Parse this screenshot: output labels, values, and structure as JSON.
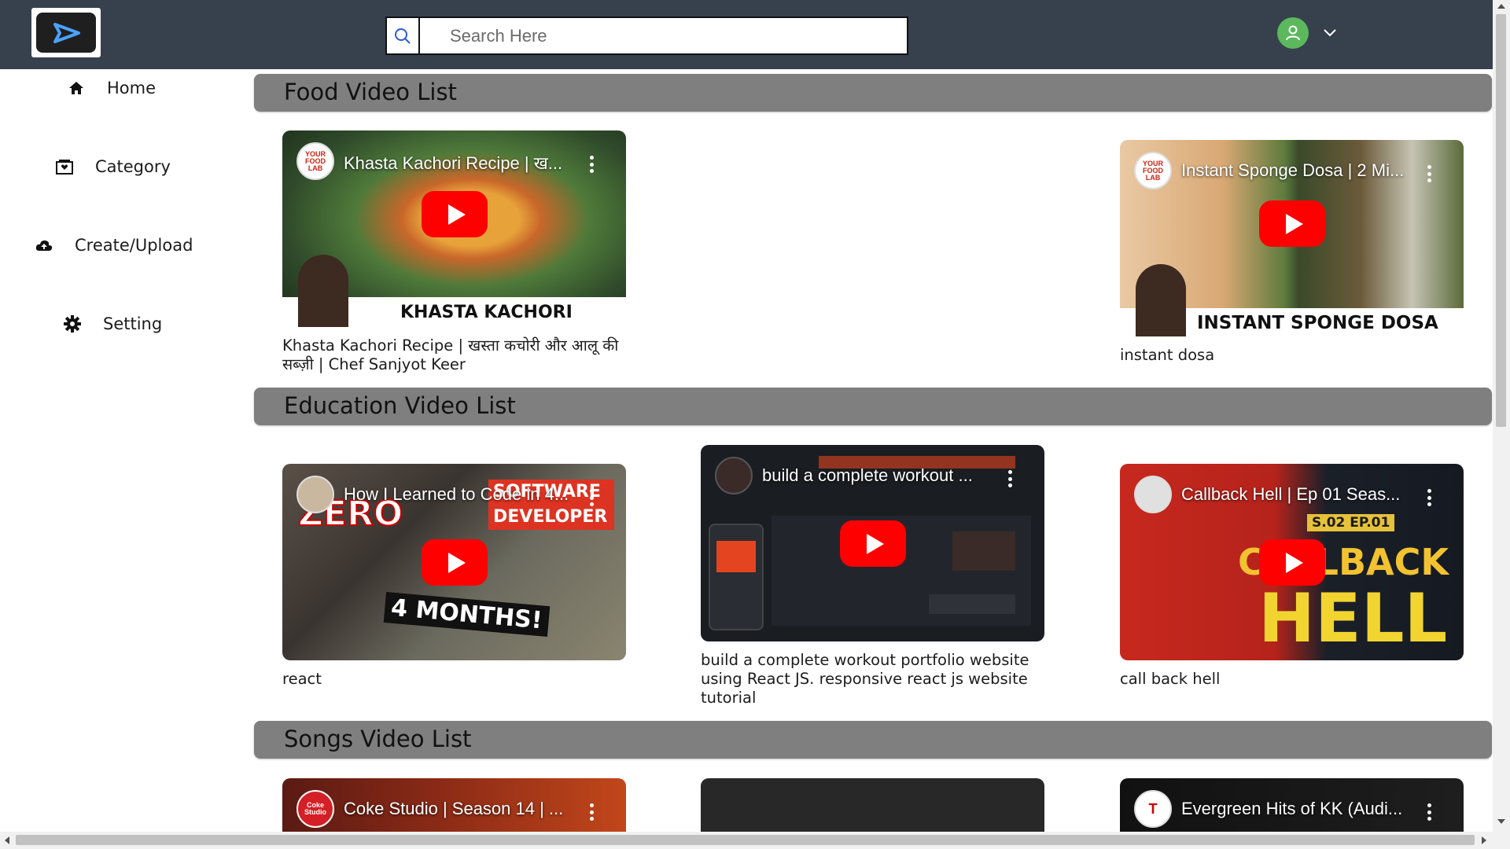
{
  "header": {
    "search_placeholder": "Search Here"
  },
  "sidebar": {
    "items": [
      {
        "label": "Home",
        "icon": "home-icon"
      },
      {
        "label": "Category",
        "icon": "category-icon"
      },
      {
        "label": "Create/Upload",
        "icon": "cloud-upload-icon"
      },
      {
        "label": "Setting",
        "icon": "gear-icon"
      }
    ]
  },
  "sections": [
    {
      "title": "Food Video List",
      "videos": [
        {
          "thumb_title": "Khasta Kachori Recipe | ख...",
          "channel": "YOUR FOOD LAB",
          "overlay": "KHASTA KACHORI",
          "caption": "Khasta Kachori Recipe | खस्ता कचोरी और आलू की सब्ज़ी | Chef Sanjyot Keer"
        },
        {
          "thumb_title": "Instant Sponge Dosa | 2 Mi...",
          "channel": "YOUR FOOD LAB",
          "overlay": "INSTANT SPONGE DOSA",
          "caption": "instant dosa"
        }
      ]
    },
    {
      "title": "Education Video List",
      "videos": [
        {
          "thumb_title": "How I Learned to Code in 4...",
          "overlay_a": "ZERO",
          "overlay_b": "SOFTWARE DEVELOPER",
          "overlay_c": "4 MONTHS!",
          "caption": "react"
        },
        {
          "thumb_title": "build a complete workout ...",
          "caption": "build a complete workout portfolio website using React JS. responsive react js website tutorial"
        },
        {
          "thumb_title": "Callback Hell | Ep 01 Seas...",
          "overlay_a": "S.02 EP.01",
          "overlay_b": "CALLBACK",
          "overlay_c": "HELL",
          "caption": "call back hell"
        }
      ]
    },
    {
      "title": "Songs Video List",
      "videos": [
        {
          "thumb_title": "Coke Studio | Season 14 | ...",
          "channel": "Coke Studio"
        },
        {
          "thumb_title": ""
        },
        {
          "thumb_title": "Evergreen Hits of KK (Audi...",
          "channel": "T"
        }
      ]
    }
  ],
  "colors": {
    "header_bg": "#37414d",
    "section_bar": "#7f7f7f",
    "play_red": "#ff0000",
    "avatar_green": "#5cb85c"
  }
}
